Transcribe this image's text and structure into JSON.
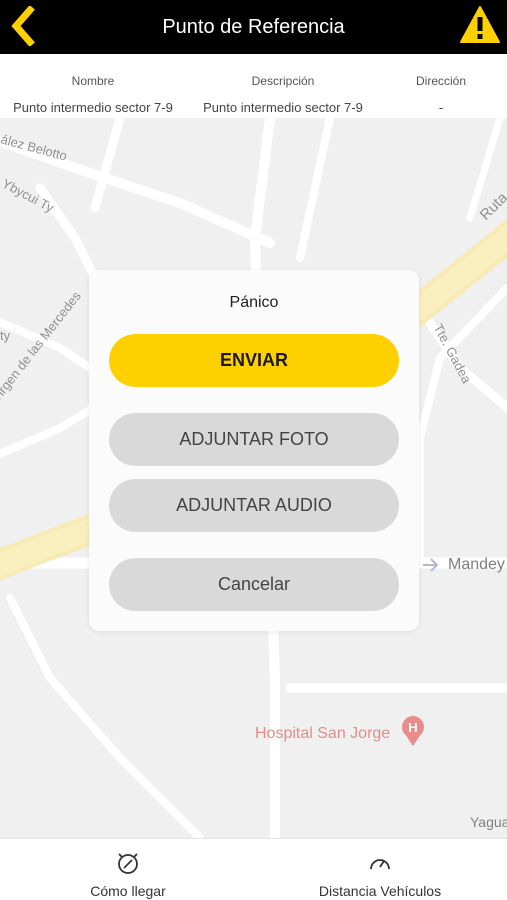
{
  "header": {
    "title": "Punto de Referencia",
    "back_icon": "chevron-left-icon",
    "warning_icon": "warning-icon",
    "accent": "#ffd000"
  },
  "info": {
    "columns": [
      {
        "header": "Nombre",
        "value": "Punto intermedio sector 7-9"
      },
      {
        "header": "Descripción",
        "value": "Punto intermedio sector 7-9"
      },
      {
        "header": "Dirección",
        "value": "-"
      }
    ]
  },
  "map": {
    "labels": {
      "belotto": "ález Belotto",
      "ybycui": "Ybycui Ty",
      "virgen": "Virgen de las Mercedes",
      "ty": "ty",
      "tte_gadea": "Tte. Gadea",
      "ruta": "Ruta",
      "mandey": "Mandey",
      "hospital": "Hospital San Jorge",
      "yagua": "Yagua"
    },
    "hospital_color": "#e06666"
  },
  "dialog": {
    "title": "Pánico",
    "send_label": "ENVIAR",
    "photo_label": "ADJUNTAR FOTO",
    "audio_label": "ADJUNTAR AUDIO",
    "cancel_label": "Cancelar"
  },
  "bottom": {
    "directions_label": "Cómo llegar",
    "directions_icon": "compass-icon",
    "distance_label": "Distancia Vehículos",
    "distance_icon": "speedometer-icon"
  }
}
